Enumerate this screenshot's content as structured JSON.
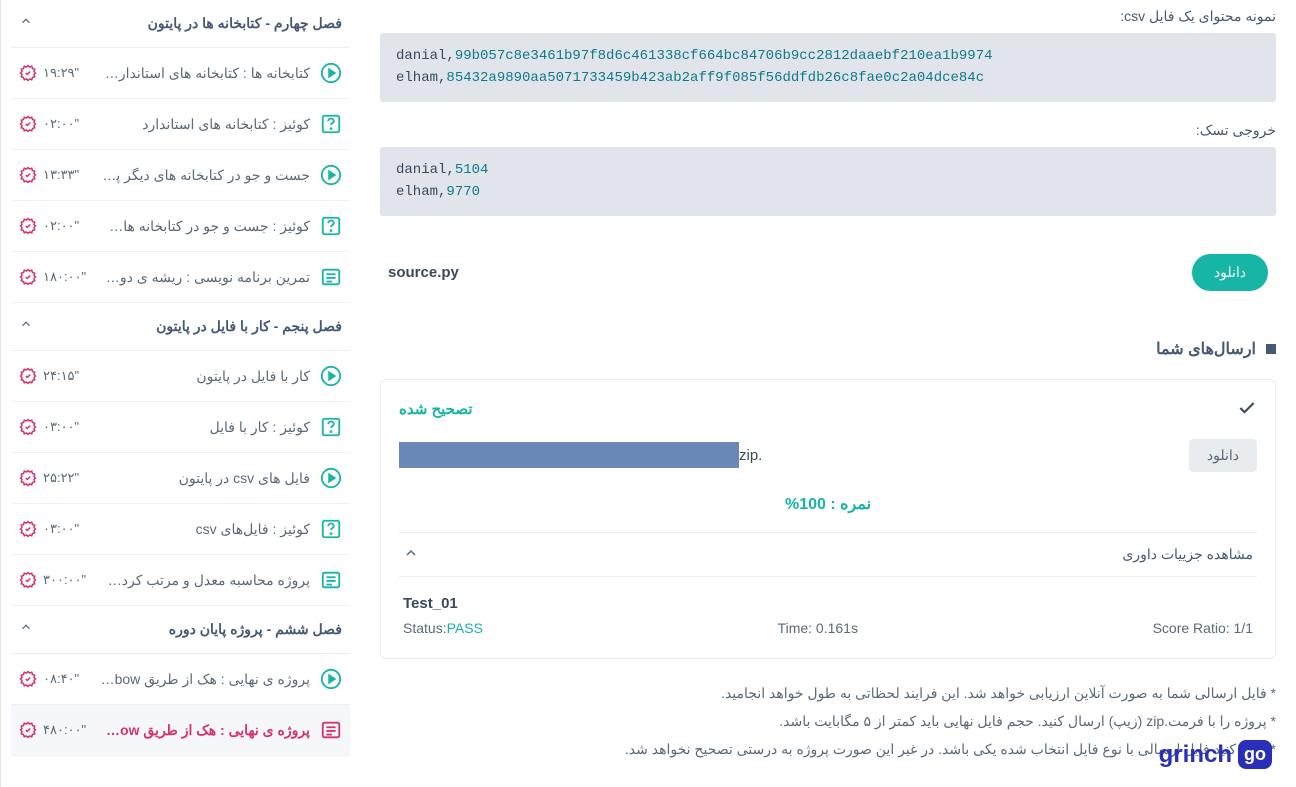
{
  "code1_label": "نمونه محتوای یک فایل csv:",
  "code1_l1a": "danial,",
  "code1_l1b": "99b057c8e3461b97f8d6c461338cf664bc84706b9cc2812daaebf210ea1b9974",
  "code1_l2a": "elham,",
  "code1_l2b": "85432a9890aa5071733459b423ab2aff9f085f56ddfdb26c8fae0c2a04dce84c",
  "code2_label": "خروجی تسک:",
  "code2_l1a": "danial,",
  "code2_l1b": "5104",
  "code2_l2a": "elham,",
  "code2_l2b": "9770",
  "download_file": "source.py",
  "download_btn": "دانلود",
  "submissions_header": "ارسال‌های شما",
  "status_corrected": "تصحیح شده",
  "file_ext": "zip.",
  "dl2": "دانلود",
  "score": "نمره : 100%",
  "judge_details": "مشاهده جزییات داوری",
  "test_name": "Test_01",
  "status_label": "Status:",
  "status_val": "PASS",
  "time_label": "Time: 0.161s",
  "ratio_label": "Score Ratio: 1/1",
  "note1": "* فایل ارسالی شما به صورت آنلاین ارزیابی خواهد شد. این فرایند لحظاتی به طول خواهد انجامید.",
  "note2": "* پروژه را با فرمت.zip (زیپ) ارسال کنید. حجم فایل نهایی باید کمتر از ۵ مگابایت باشد.",
  "note3": "* دقت کنید فایل ارسالی با نوع فایل انتخاب شده یکی باشد. در غیر این صورت پروژه به درستی تصحیح نخواهد شد.",
  "sec4": "فصل چهارم - کتابخانه ها در پایتون",
  "sec5": "فصل پنجم - کار با فایل در پایتون",
  "sec6": "فصل ششم - پروژه پایان دوره",
  "i1": "کتابخانه ها : کتابخانه های استاندارد ...",
  "t1": "۱۹:۲۹\"",
  "i2": "کوئیز : کتابخانه های استاندارد",
  "t2": "۰۲:۰۰\"",
  "i3": "جست و جو در کتابخانه های دیگر پای...",
  "t3": "۱۳:۳۳\"",
  "i4": "کوئیز : جست و جو در کتابخانه های ...",
  "t4": "۰۲:۰۰\"",
  "i5": "تمرین برنامه نویسی : ریشه ی دوم ...",
  "t5": "۱۸۰:۰۰\"",
  "i6": "کار با فایل در پایتون",
  "t6": "۲۴:۱۵\"",
  "i7": "کوئیز : کار با فایل",
  "t7": "۰۳:۰۰\"",
  "i8": "فایل های csv در پایتون",
  "t8": "۲۵:۲۲\"",
  "i9": "کوئیز : فایل‌های csv",
  "t9": "۰۳:۰۰\"",
  "i10": "پروژه محاسبه معدل و مرتب کردن مع...",
  "t10": "۳۰۰:۰۰\"",
  "i11": "پروژه ی نهایی : هک از طریق Rainbow",
  "t11": "۰۸:۴۰\"",
  "i12": "پروژه ی نهایی : هک از طریق ainbow...",
  "t12": "۴۸۰:۰۰\"",
  "logo_badge": "go",
  "logo_text": "grinch"
}
